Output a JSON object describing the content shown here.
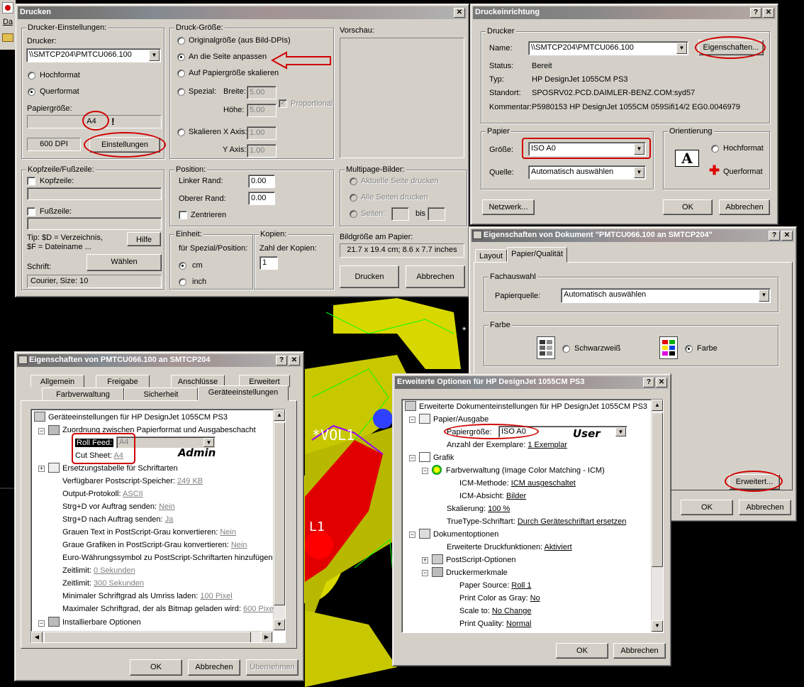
{
  "app": {
    "title_fragment": "Da"
  },
  "drucken": {
    "title": "Drucken",
    "printer_group": "Drucker-Einstellungen:",
    "printer_label": "Drucker:",
    "printer_value": "\\\\SMTCP204\\PMTCU066.100",
    "hochformat": "Hochformat",
    "querformat": "Querformat",
    "paper_label": "Papiergröße:",
    "paper_value": "A4",
    "dpi": "600 DPI",
    "einstellungen": "Einstellungen",
    "size_group": "Druck-Größe:",
    "original": "Originalgröße (aus Bild-DPIs)",
    "fit_page": "An die Seite anpassen",
    "fit_paper": "Auf Papiergröße skalieren",
    "spezial": "Spezial:",
    "breite": "Breite:",
    "breite_val": "5.00",
    "hoehe": "Höhe:",
    "hoehe_val": "5.00",
    "proportional": "Proportional",
    "skalieren_x": "Skalieren X Axis:",
    "x_val": "1.00",
    "y_axis": "Y Axis:",
    "y_val": "1.00",
    "preview": "Vorschau:",
    "header_group": "Kopfzeile/Fußzeile:",
    "kopfzeile": "Kopfzeile:",
    "fusszeile": "Fußzeile:",
    "tip1": "Tip: $D = Verzeichnis,",
    "tip2": "$F = Dateiname ...",
    "hilfe": "Hilfe",
    "schrift": "Schrift:",
    "waehlen": "Wählen",
    "font_value": "Courier, Size: 10",
    "position_group": "Position:",
    "linker_rand": "Linker Rand:",
    "linker_val": "0.00",
    "oberer_rand": "Oberer Rand:",
    "oberer_val": "0.00",
    "zentrieren": "Zentrieren",
    "multipage_group": "Multipage-Bilder:",
    "aktuelle": "Aktuelle Seite drucken",
    "alle": "Alle Seiten drucken",
    "seiten": "Seiten:",
    "bis": "bis",
    "einheit_group": "Einheit:",
    "fuer_spezial": "für Spezial/Position:",
    "cm": "cm",
    "inch": "inch",
    "kopien_group": "Kopien:",
    "zahl_kopien": "Zahl der Kopien:",
    "kopien_val": "1",
    "bildgroesse_label": "Bildgröße am Papier:",
    "bildgroesse_val": "21.7 x 19.4 cm; 8.6 x 7.7 inches",
    "drucken_btn": "Drucken",
    "abbrechen": "Abbrechen"
  },
  "einrichtung": {
    "title": "Druckeinrichtung",
    "drucker_group": "Drucker",
    "name_label": "Name:",
    "name_val": "\\\\SMTCP204\\PMTCU066.100",
    "eigenschaften": "Eigenschaften...",
    "status_label": "Status:",
    "status_val": "Bereit",
    "typ_label": "Typ:",
    "typ_val": "HP DesignJet 1055CM PS3",
    "standort_label": "Standort:",
    "standort_val": "SPOSRV02.PCD.DAIMLER-BENZ.COM:syd57",
    "kommentar_label": "Kommentar:",
    "kommentar_val": "P5980153 HP DesignJet 1055CM 059Sifi14/2 EG0.0046979",
    "papier_group": "Papier",
    "groesse_label": "Größe:",
    "groesse_val": "ISO A0",
    "quelle_label": "Quelle:",
    "quelle_val": "Automatisch auswählen",
    "orient_group": "Orientierung",
    "hochformat": "Hochformat",
    "querformat": "Querformat",
    "netzwerk": "Netzwerk...",
    "ok": "OK",
    "abbrechen": "Abbrechen"
  },
  "dok": {
    "title": "Eigenschaften von Dokument \"PMTCU066.100 an SMTCP204\"",
    "tab_layout": "Layout",
    "tab_papier": "Papier/Qualität",
    "fach_group": "Fachauswahl",
    "papierquelle": "Papierquelle:",
    "papierquelle_val": "Automatisch auswählen",
    "farbe_group": "Farbe",
    "schwarzweiss": "Schwarzweiß",
    "farbe": "Farbe",
    "erweitert": "Erweitert...",
    "ok": "OK",
    "abbrechen": "Abbrechen"
  },
  "props": {
    "title": "Eigenschaften von PMTCU066.100 an SMTCP204",
    "tabs_row1": [
      "Allgemein",
      "Freigabe",
      "Anschlüsse",
      "Erweitert"
    ],
    "tabs_row2": [
      "Farbverwaltung",
      "Sicherheit",
      "Geräteeinstellungen"
    ],
    "tree": {
      "root": "Geräteeinstellungen für HP DesignJet 1055CM PS3",
      "zuordnung": "Zuordnung zwischen Papierformat und Ausgabeschacht",
      "roll_feed": "Roll Feed:",
      "roll_feed_val": "A4",
      "cut_sheet": "Cut Sheet:",
      "cut_sheet_val": "A4",
      "ersetzung": "Ersetzungstabelle für Schriftarten",
      "ps_speicher": "Verfügbarer Postscript-Speicher:",
      "ps_speicher_val": "249 KB",
      "output": "Output-Protokoll:",
      "output_val": "ASCII",
      "strgd_vor": "Strg+D vor Auftrag senden:",
      "strgd_vor_val": "Nein",
      "strgd_nach": "Strg+D nach Auftrag senden:",
      "strgd_nach_val": "Ja",
      "grau_text": "Grauen Text in PostScript-Grau konvertieren:",
      "grau_text_val": "Nein",
      "grau_graf": "Graue Grafiken in PostScript-Grau konvertieren:",
      "grau_graf_val": "Nein",
      "euro": "Euro-Währungssymbol zu PostScript-Schriftarten hinzufügen:",
      "zeitlimit1": "Zeitlimit:",
      "zeitlimit1_val": "0 Sekunden",
      "zeitlimit2": "Zeitlimit:",
      "zeitlimit2_val": "300 Sekunden",
      "min_schrift": "Minimaler Schriftgrad als Umriss laden:",
      "min_schrift_val": "100 Pixel",
      "max_schrift": "Maximaler Schriftgrad, der als Bitmap geladen wird:",
      "max_schrift_val": "600 Pixel",
      "installierbar": "Installierbare Optionen"
    },
    "ok": "OK",
    "abbrechen": "Abbrechen",
    "uebernehmen": "Übernehmen",
    "annotation": "Admin"
  },
  "erw": {
    "title": "Erweiterte Optionen für HP DesignJet 1055CM PS3",
    "tree": {
      "root": "Erweiterte Dokumenteinstellungen für HP DesignJet 1055CM PS3",
      "papier_ausgabe": "Papier/Ausgabe",
      "papiergroesse": "Papiergröße:",
      "papiergroesse_val": "ISO A0",
      "exemplare": "Anzahl der Exemplare:",
      "exemplare_val": "1 Exemplar",
      "grafik": "Grafik",
      "farbverwaltung": "Farbverwaltung (Image Color Matching - ICM)",
      "icm_methode": "ICM-Methode:",
      "icm_methode_val": "ICM ausgeschaltet",
      "icm_absicht": "ICM-Absicht:",
      "icm_absicht_val": "Bilder",
      "skalierung": "Skalierung:",
      "skalierung_val": "100 %",
      "truetype": "TrueType-Schriftart:",
      "truetype_val": "Durch Geräteschriftart ersetzen",
      "dokumentoptionen": "Dokumentoptionen",
      "erw_druck": "Erweiterte Druckfunktionen:",
      "erw_druck_val": "Aktiviert",
      "ps_optionen": "PostScript-Optionen",
      "druckermerkmale": "Druckermerkmale",
      "paper_source": "Paper Source:",
      "paper_source_val": "Roll 1",
      "print_gray": "Print Color as Gray:",
      "print_gray_val": "No",
      "scale_to": "Scale to:",
      "scale_to_val": "No Change",
      "print_quality": "Print Quality:",
      "print_quality_val": "Normal"
    },
    "ok": "OK",
    "abbrechen": "Abbrechen",
    "annotation": "User"
  },
  "colors": {
    "highlight": "#d00000",
    "titlebar": "#808080",
    "face": "#d4d0c8"
  }
}
